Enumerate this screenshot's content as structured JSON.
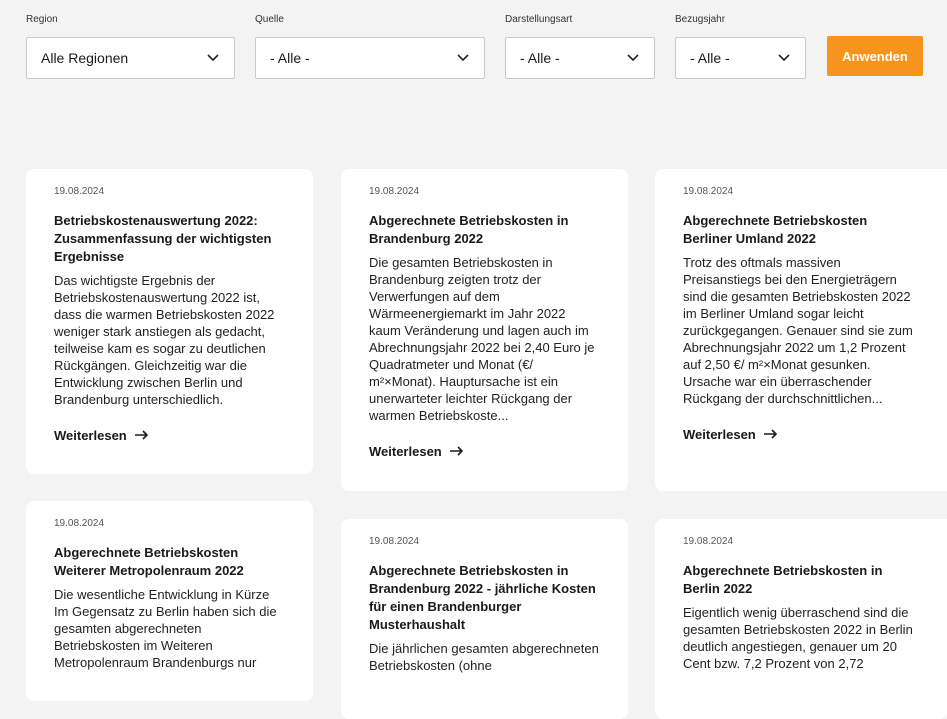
{
  "filters": {
    "region": {
      "label": "Region",
      "value": "Alle Regionen"
    },
    "quelle": {
      "label": "Quelle",
      "value": "- Alle -"
    },
    "darstellungsart": {
      "label": "Darstellungsart",
      "value": "- Alle -"
    },
    "bezugsjahr": {
      "label": "Bezugsjahr",
      "value": "- Alle -"
    },
    "apply_label": "Anwenden"
  },
  "colors": {
    "accent": "#f7941e",
    "background": "#f3f3f3",
    "card": "#ffffff"
  },
  "read_more_label": "Weiterlesen",
  "cards": [
    {
      "date": "19.08.2024",
      "title": "Betriebskostenauswertung 2022: Zusammenfassung der wichtigsten Ergebnisse",
      "text": "Das wichtigste Ergebnis der Betriebskostenauswertung 2022 ist, dass die warmen Betriebskosten 2022 weniger stark anstiegen als gedacht, teilweise kam es sogar zu deutlichen Rückgängen. Gleichzeitig war die Entwicklung zwischen Berlin und Brandenburg unterschiedlich."
    },
    {
      "date": "19.08.2024",
      "title": "Abgerechnete Betriebskosten in Brandenburg 2022",
      "text": "Die gesamten Betriebskosten in Brandenburg zeigten trotz der Verwerfungen auf dem Wärmeenergiemarkt im Jahr 2022 kaum Veränderung und lagen auch im Abrechnungsjahr 2022 bei 2,40 Euro je Quadratmeter und Monat (€/ m²×Monat). Hauptursache ist ein unerwarteter leichter Rückgang der warmen Betriebskoste..."
    },
    {
      "date": "19.08.2024",
      "title": "Abgerechnete Betriebskosten Berliner Umland 2022",
      "text": "Trotz des oftmals massiven Preisanstiegs bei den Energieträgern sind die gesamten Betriebskosten 2022 im Berliner Umland sogar leicht zurückgegangen. Genauer sind sie zum Abrechnungsjahr 2022 um 1,2 Prozent auf 2,50 €/ m²×Monat gesunken. Ursache war ein überraschender Rückgang der durchschnittlichen..."
    },
    {
      "date": "19.08.2024",
      "title": "Abgerechnete Betriebskosten Weiterer Metropolenraum 2022",
      "text": "Die wesentliche Entwicklung in Kürze Im Gegensatz zu Berlin haben sich die gesamten abgerechneten Betriebskosten im Weiteren Metropolenraum Brandenburgs nur"
    },
    {
      "date": "19.08.2024",
      "title": "Abgerechnete Betriebskosten in Brandenburg 2022 - jährliche Kosten für einen Brandenburger Musterhaushalt",
      "text": "Die jährlichen gesamten abgerechneten Betriebskosten (ohne"
    },
    {
      "date": "19.08.2024",
      "title": "Abgerechnete Betriebskosten in Berlin 2022",
      "text": "Eigentlich wenig überraschend sind die gesamten Betriebskosten 2022 in Berlin deutlich angestiegen, genauer um 20 Cent bzw. 7,2 Prozent von 2,72"
    }
  ]
}
